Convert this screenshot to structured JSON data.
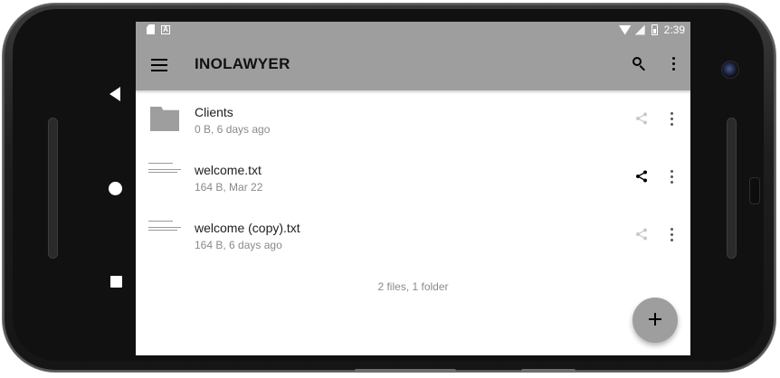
{
  "status_bar": {
    "time": "2:39"
  },
  "app_bar": {
    "title": "INOLAWYER"
  },
  "files": [
    {
      "name": "Clients",
      "meta": "0 B, 6 days ago",
      "icon": "folder-icon",
      "share_active": false
    },
    {
      "name": "welcome.txt",
      "meta": "164 B, Mar 22",
      "icon": "document-thumbnail",
      "share_active": true
    },
    {
      "name": "welcome (copy).txt",
      "meta": "164 B, 6 days ago",
      "icon": "document-thumbnail",
      "share_active": false
    }
  ],
  "summary": "2 files, 1 folder",
  "colors": {
    "app_bar": "#9e9e9e",
    "fab": "#9e9e9e",
    "share_active": "#000000",
    "share_inactive": "#c8c8c8"
  }
}
